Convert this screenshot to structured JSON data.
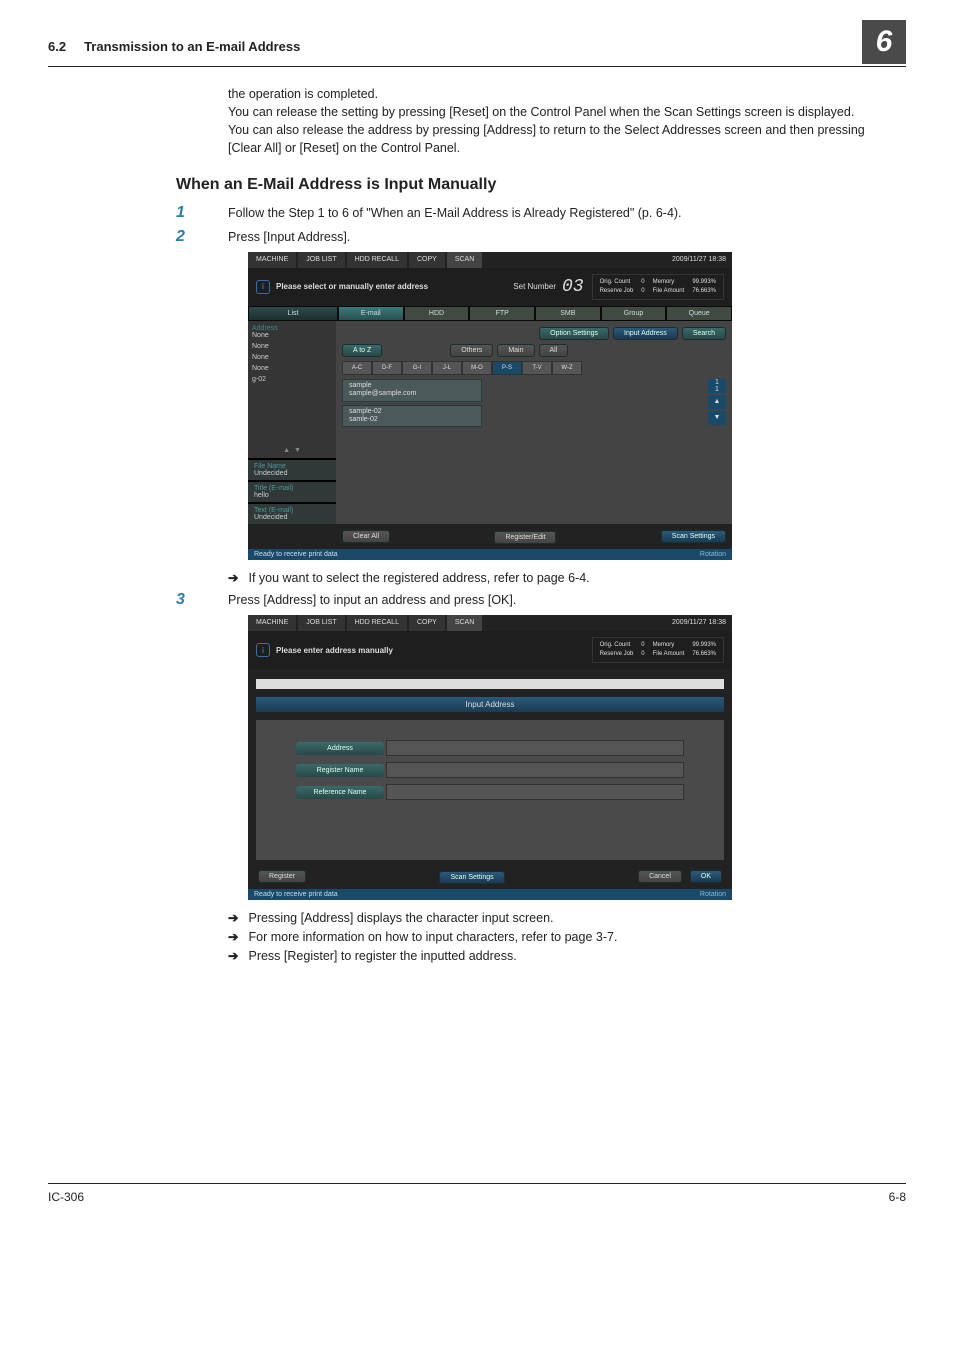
{
  "header": {
    "section_no": "6.2",
    "section_title": "Transmission to an E-mail Address",
    "chapter": "6"
  },
  "intro": {
    "line1": "the operation is completed.",
    "para": "You can release the setting by pressing [Reset] on the Control Panel when the Scan Settings screen is displayed. You can also release the address by pressing [Address] to return to the Select Addresses screen and then pressing [Clear All] or [Reset] on the Control Panel."
  },
  "h2": "When an E-Mail Address is Input Manually",
  "steps": {
    "s1": "Follow the Step 1 to 6 of \"When an E-Mail Address is Already Registered\" (p. 6-4).",
    "s2": "Press [Input Address].",
    "s2_note": "If you want to select the registered address, refer to page 6-4.",
    "s3": "Press [Address] to input an address and press [OK].",
    "s3_n1": "Pressing [Address] displays the character input screen.",
    "s3_n2": "For more information on how to input characters, refer to page 3-7.",
    "s3_n3": "Press [Register] to register the inputted address."
  },
  "shot_common": {
    "topbar": {
      "machine": "MACHINE",
      "joblist": "JOB LIST",
      "hddrecall": "HDD RECALL",
      "copy": "COPY",
      "scan": "SCAN",
      "timestamp": "2009/11/27 18:38"
    },
    "stats": {
      "orig": "Orig. Count",
      "orig_v": "0",
      "mem": "Memory",
      "mem_v": "99.993%",
      "rsv": "Reserve Job",
      "rsv_v": "0",
      "file": "File Amount",
      "file_v": "76.663%"
    },
    "status": "Ready to receive print data",
    "rotation": "Rotation"
  },
  "shot1": {
    "msg": "Please select or manually enter address",
    "setnum_label": "Set Number",
    "setnum_value": "03",
    "tabs": {
      "list": "List",
      "email": "E-mail",
      "hdd": "HDD",
      "ftp": "FTP",
      "smb": "SMB",
      "group": "Group",
      "queue": "Queue"
    },
    "sidebar": {
      "address": "Address",
      "none": "None",
      "g02": "g-02",
      "filename": "File Name",
      "undec": "Undecided",
      "titleem": "Title (E-mail)",
      "hello": "hello",
      "textem": "Text (E-mail)"
    },
    "btns": {
      "atof": "A to Z",
      "others": "Others",
      "main": "Main",
      "all": "All",
      "option": "Option Settings",
      "input": "Input Address",
      "search": "Search",
      "clearall": "Clear All",
      "regedit": "Register/Edit",
      "scanset": "Scan Settings"
    },
    "alpha": {
      "ac": "A-C",
      "df": "D-F",
      "gi": "G-I",
      "jl": "J-L",
      "mo": "M-O",
      "ps": "P-S",
      "tv": "T-V",
      "wz": "W-Z"
    },
    "entries": {
      "e1n": "sample",
      "e1a": "sample@sample.com",
      "e2n": "sample-02",
      "e2a": "samle-02"
    },
    "counter": "1\n1"
  },
  "shot2": {
    "msg": "Please enter address manually",
    "band": "Input Address",
    "fields": {
      "addr": "Address",
      "regname": "Register Name",
      "refname": "Reference Name"
    },
    "btns": {
      "register": "Register",
      "scanset": "Scan Settings",
      "cancel": "Cancel",
      "ok": "OK"
    }
  },
  "footer": {
    "left": "IC-306",
    "right": "6-8"
  }
}
